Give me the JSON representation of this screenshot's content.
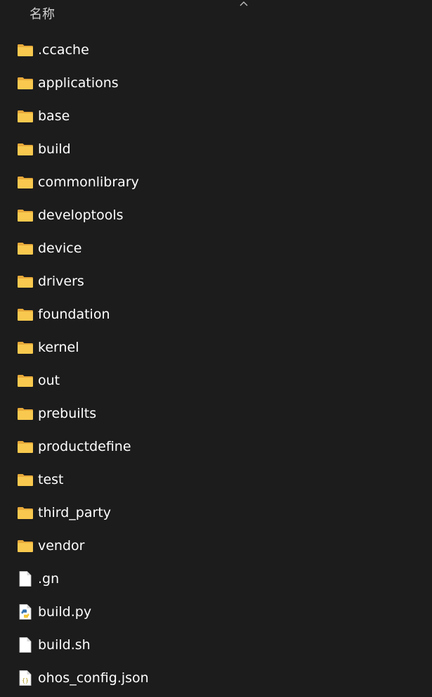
{
  "header": {
    "column_name_label": "名称",
    "sort_icon": "chevron-up-icon"
  },
  "items": [
    {
      "name": ".ccache",
      "type": "folder",
      "icon": "folder-icon"
    },
    {
      "name": "applications",
      "type": "folder",
      "icon": "folder-icon"
    },
    {
      "name": "base",
      "type": "folder",
      "icon": "folder-icon"
    },
    {
      "name": "build",
      "type": "folder",
      "icon": "folder-icon"
    },
    {
      "name": "commonlibrary",
      "type": "folder",
      "icon": "folder-icon"
    },
    {
      "name": "developtools",
      "type": "folder",
      "icon": "folder-icon"
    },
    {
      "name": "device",
      "type": "folder",
      "icon": "folder-icon"
    },
    {
      "name": "drivers",
      "type": "folder",
      "icon": "folder-icon"
    },
    {
      "name": "foundation",
      "type": "folder",
      "icon": "folder-icon"
    },
    {
      "name": "kernel",
      "type": "folder",
      "icon": "folder-icon"
    },
    {
      "name": "out",
      "type": "folder",
      "icon": "folder-icon"
    },
    {
      "name": "prebuilts",
      "type": "folder",
      "icon": "folder-icon"
    },
    {
      "name": "productdefine",
      "type": "folder",
      "icon": "folder-icon"
    },
    {
      "name": "test",
      "type": "folder",
      "icon": "folder-icon"
    },
    {
      "name": "third_party",
      "type": "folder",
      "icon": "folder-icon"
    },
    {
      "name": "vendor",
      "type": "folder",
      "icon": "folder-icon"
    },
    {
      "name": ".gn",
      "type": "file",
      "icon": "file-icon"
    },
    {
      "name": "build.py",
      "type": "python",
      "icon": "python-file-icon"
    },
    {
      "name": "build.sh",
      "type": "file",
      "icon": "file-icon"
    },
    {
      "name": "ohos_config.json",
      "type": "json",
      "icon": "json-file-icon"
    }
  ],
  "colors": {
    "background": "#1c1c1c",
    "text": "#ffffff",
    "folder_body": "#f8c94e",
    "folder_back": "#e7a93a"
  }
}
